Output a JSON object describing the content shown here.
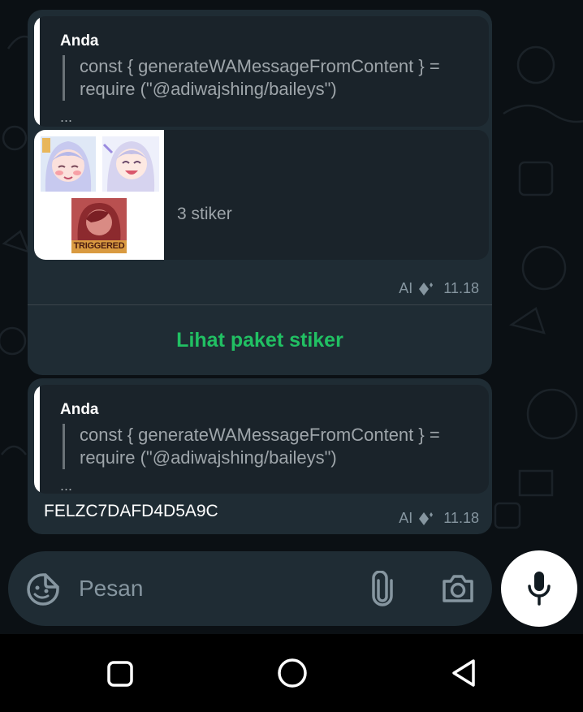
{
  "messages": [
    {
      "quote": {
        "author": "Anda",
        "lines": [
          "const { generateWAMessageFromContent } =",
          "require (\"@adiwajshing/baileys\")"
        ],
        "ellipsis": "..."
      },
      "sticker_pack": {
        "count_label": "3 stiker",
        "stickers": [
          "anime-girl-blushing",
          "anime-girl-laughing",
          "triggered-meme"
        ],
        "triggered_text": "TRIGGERED"
      },
      "meta": {
        "ai_label": "AI",
        "time": "11.18"
      },
      "action_label": "Lihat paket stiker"
    },
    {
      "quote": {
        "author": "Anda",
        "lines": [
          "const { generateWAMessageFromContent } =",
          "require (\"@adiwajshing/baileys\")"
        ],
        "ellipsis": "..."
      },
      "text": "FELZC7DAFD4D5A9C",
      "meta": {
        "ai_label": "AI",
        "time": "11.18"
      }
    }
  ],
  "composer": {
    "placeholder": "Pesan",
    "icons": [
      "sticker-icon",
      "attach-icon",
      "camera-icon",
      "mic-icon"
    ]
  },
  "navigation": [
    "recents-square-icon",
    "home-circle-icon",
    "back-triangle-icon"
  ],
  "colors": {
    "background": "#0b1014",
    "bubble": "#1f2c34",
    "accent_green": "#21c063",
    "muted_text": "#8696a0"
  }
}
